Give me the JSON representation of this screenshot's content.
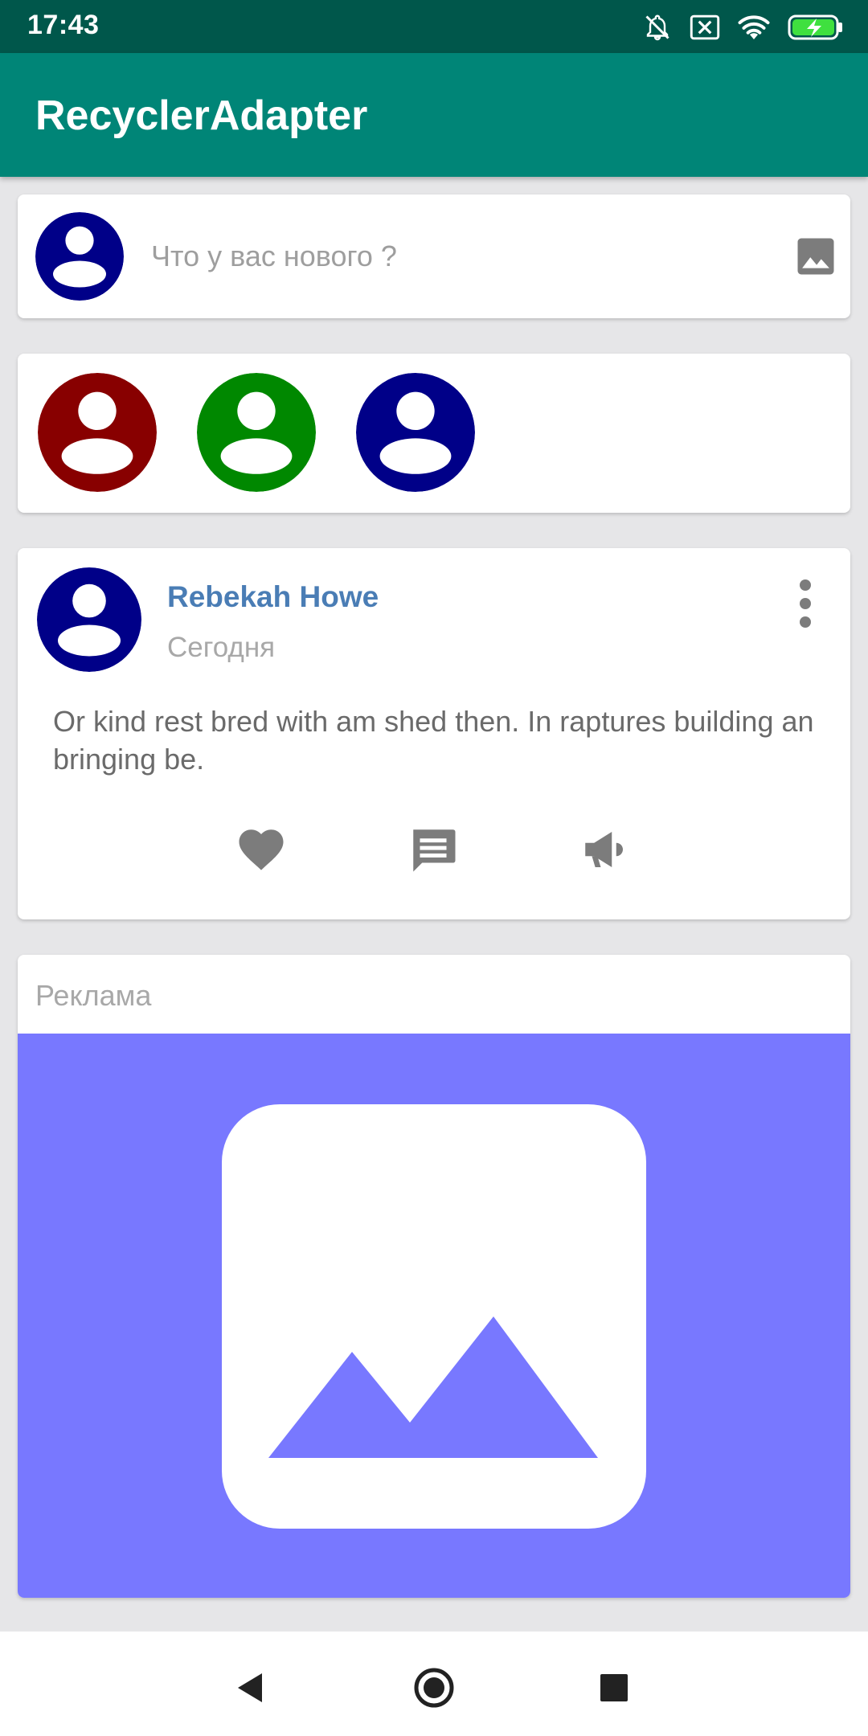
{
  "status_bar": {
    "time": "17:43",
    "icons": [
      "mute-bell-icon",
      "sim-off-icon",
      "wifi-icon",
      "battery-charging-icon"
    ]
  },
  "app_bar": {
    "title": "RecyclerAdapter"
  },
  "composer": {
    "placeholder": "Что у вас нового ?",
    "avatar_color": "#000088",
    "photo_icon": "image-icon"
  },
  "stories": [
    {
      "avatar_color": "#880000"
    },
    {
      "avatar_color": "#008800"
    },
    {
      "avatar_color": "#000088"
    }
  ],
  "post": {
    "author": "Rebekah Howe",
    "date": "Сегодня",
    "text": "Or kind rest bred with am shed then. In raptures building an bringing be.",
    "avatar_color": "#000088",
    "actions": [
      "like-icon",
      "comment-icon",
      "share-icon"
    ]
  },
  "ad": {
    "label": "Реклама",
    "background": "#7878ff"
  },
  "nav_bar": {
    "buttons": [
      "back-icon",
      "home-icon",
      "recents-icon"
    ]
  },
  "colors": {
    "status_bar": "#00574b",
    "app_bar": "#008577",
    "author_link": "#4a7db5",
    "icon_gray": "#808080"
  }
}
